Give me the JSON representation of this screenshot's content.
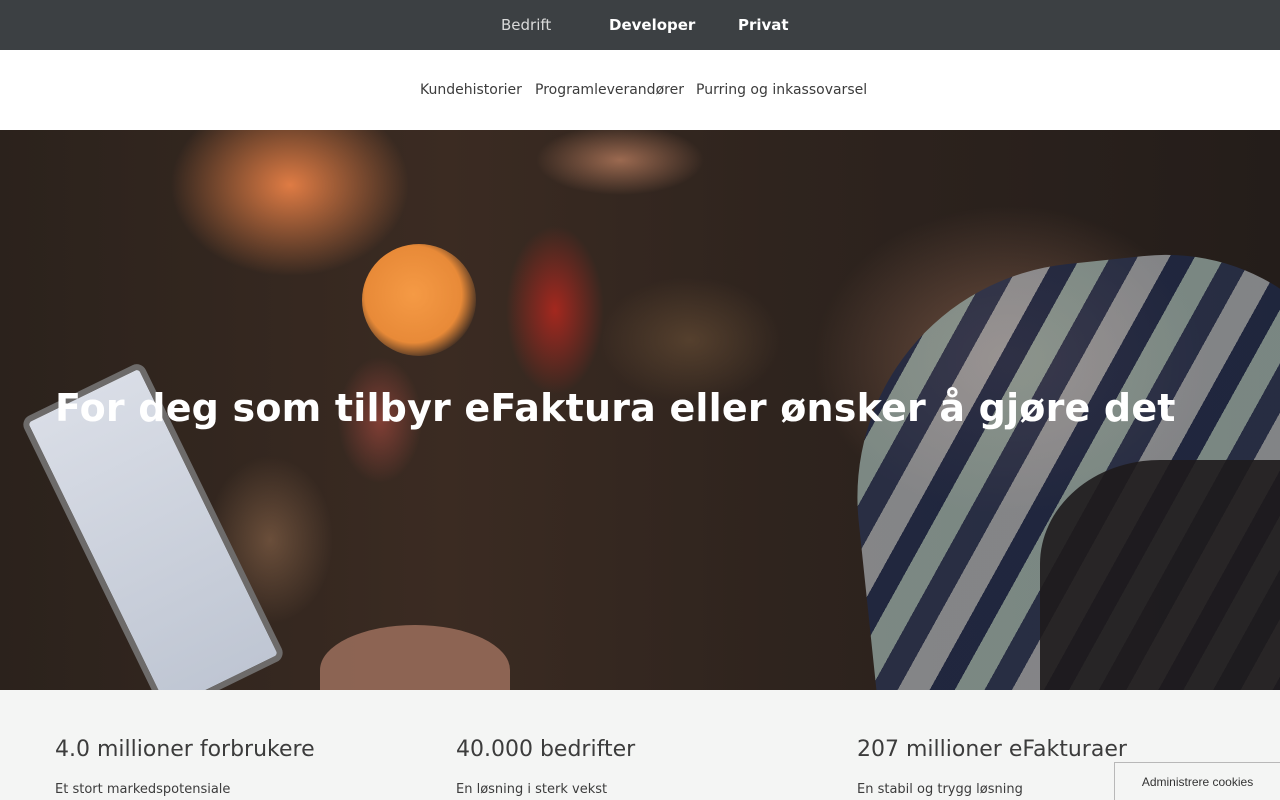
{
  "top_nav": {
    "items": [
      "Bedrift",
      "Developer",
      "Privat"
    ]
  },
  "sub_nav": {
    "items": [
      "Kundehistorier",
      "Programleverandører",
      "Purring og inkassovarsel"
    ]
  },
  "hero": {
    "title": "For deg som tilbyr eFaktura eller ønsker å gjøre det"
  },
  "stats": [
    {
      "title": "4.0 millioner forbrukere",
      "subtitle": "Et stort markedspotensiale"
    },
    {
      "title": "40.000 bedrifter",
      "subtitle": "En løsning i sterk vekst"
    },
    {
      "title": "207 millioner eFakturaer",
      "subtitle": "En stabil og trygg løsning"
    }
  ],
  "cookie": {
    "label": "Administrere cookies"
  },
  "colors": {
    "topbar_bg": "#3c4043",
    "stats_bg": "#f4f5f4",
    "text": "#3c3c3c"
  }
}
